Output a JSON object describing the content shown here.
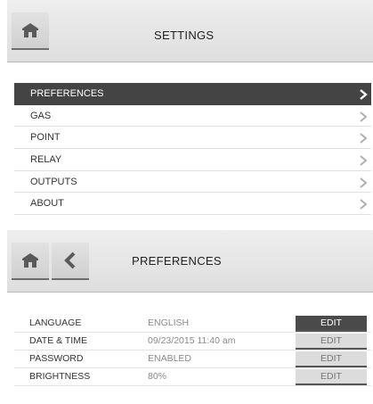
{
  "settings": {
    "title": "SETTINGS",
    "items": [
      {
        "label": "PREFERENCES",
        "active": true
      },
      {
        "label": "GAS",
        "active": false
      },
      {
        "label": "POINT",
        "active": false
      },
      {
        "label": "RELAY",
        "active": false
      },
      {
        "label": "OUTPUTS",
        "active": false
      },
      {
        "label": "ABOUT",
        "active": false
      }
    ]
  },
  "preferences": {
    "title": "PREFERENCES",
    "edit_label": "EDIT",
    "rows": [
      {
        "label": "LANGUAGE",
        "value": "ENGLISH",
        "edit_active": true
      },
      {
        "label": "DATE & TIME",
        "value": "09/23/2015 11:40 am",
        "edit_active": false
      },
      {
        "label": "PASSWORD",
        "value": "ENABLED",
        "edit_active": false
      },
      {
        "label": "BRIGHTNESS",
        "value": "80%",
        "edit_active": false
      }
    ]
  },
  "icons": {
    "home": "home-icon",
    "back": "chevron-left-icon",
    "item_arrow": "chevron-right-icon"
  },
  "colors": {
    "active_bg": "#444444",
    "chevron_active": "#ffffff",
    "chevron_inactive": "#b0b0b0"
  }
}
